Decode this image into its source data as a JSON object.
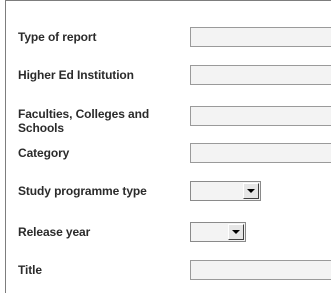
{
  "form": {
    "fields": [
      {
        "label": "Type of report",
        "type": "text",
        "value": ""
      },
      {
        "label": "Higher Ed Institution",
        "type": "text",
        "value": ""
      },
      {
        "label": "Faculties, Colleges and Schools",
        "type": "text",
        "value": ""
      },
      {
        "label": "Category",
        "type": "text",
        "value": ""
      },
      {
        "label": "Study programme type",
        "type": "select",
        "selected": ""
      },
      {
        "label": "Release year",
        "type": "select",
        "selected": ""
      },
      {
        "label": "Title",
        "type": "text",
        "value": ""
      }
    ]
  },
  "icons": {
    "dropdown": "chevron-down-icon"
  }
}
